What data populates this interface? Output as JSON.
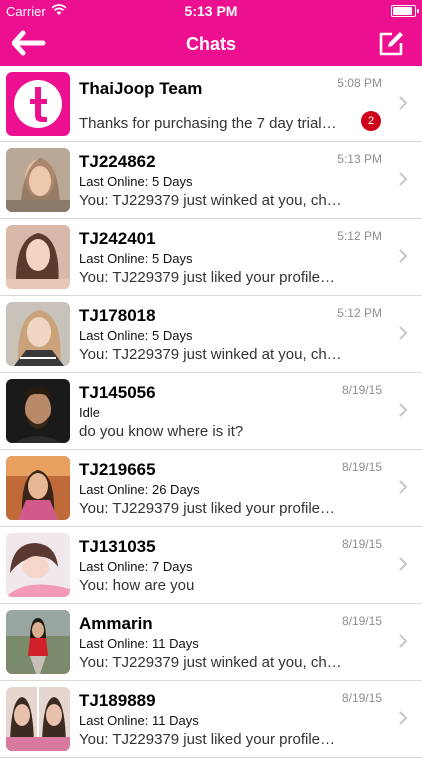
{
  "status_bar": {
    "carrier": "Carrier",
    "time": "5:13 PM"
  },
  "nav": {
    "title": "Chats"
  },
  "colors": {
    "brand": "#ec0f8f",
    "badge": "#d0021b",
    "muted": "#8e8e93"
  },
  "chats": [
    {
      "name": "ThaiJoop Team",
      "status": "",
      "message": "Thanks for purchasing the 7 day trial…",
      "time": "5:08 PM",
      "unread": "2"
    },
    {
      "name": "TJ224862",
      "status": "Last Online: 5 Days",
      "message": "You: TJ229379 just winked at you, ch…",
      "time": "5:13 PM"
    },
    {
      "name": "TJ242401",
      "status": "Last Online: 5 Days",
      "message": "You: TJ229379 just liked your profile…",
      "time": "5:12 PM"
    },
    {
      "name": "TJ178018",
      "status": "Last Online: 5 Days",
      "message": "You: TJ229379 just winked at you, ch…",
      "time": "5:12 PM"
    },
    {
      "name": "TJ145056",
      "status": "Idle",
      "message": "do you know where is it?",
      "time": "8/19/15"
    },
    {
      "name": "TJ219665",
      "status": "Last Online: 26 Days",
      "message": "You: TJ229379 just liked your profile…",
      "time": "8/19/15"
    },
    {
      "name": "TJ131035",
      "status": "Last Online: 7 Days",
      "message": "You: how are you",
      "time": "8/19/15"
    },
    {
      "name": "Ammarin",
      "status": "Last Online: 11 Days",
      "message": "You: TJ229379 just winked at you, ch…",
      "time": "8/19/15"
    },
    {
      "name": "TJ189889",
      "status": "Last Online: 11 Days",
      "message": "You: TJ229379 just liked your profile…",
      "time": "8/19/15"
    }
  ]
}
